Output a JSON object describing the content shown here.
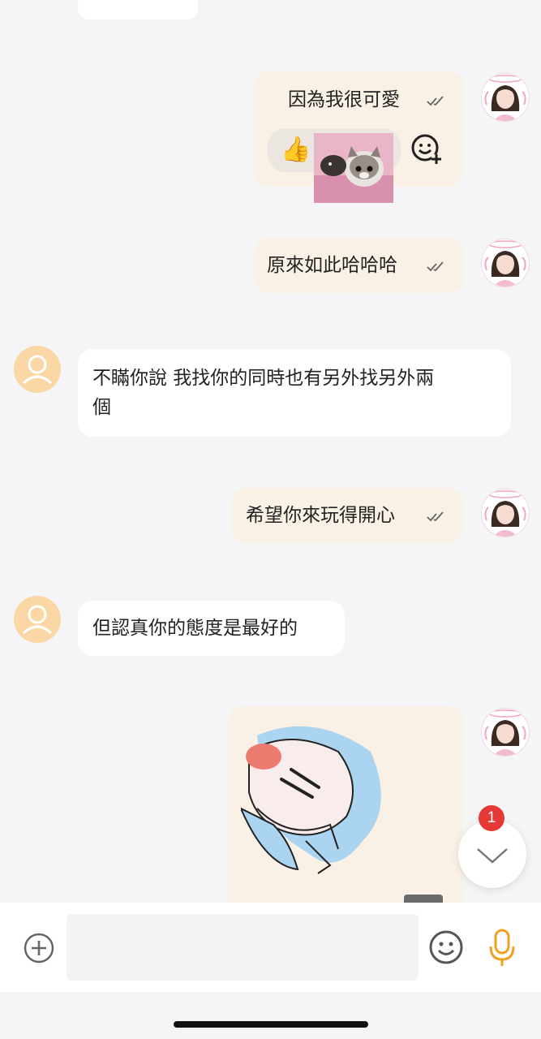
{
  "messages": [
    {
      "id": "m1",
      "direction": "outgoing",
      "text": "因為我很可愛",
      "status": "read",
      "reaction": {
        "emoji": "👍",
        "sticker": "kitten-sticker"
      }
    },
    {
      "id": "m2",
      "direction": "outgoing",
      "text": "原來如此哈哈哈",
      "status": "read"
    },
    {
      "id": "m3",
      "direction": "incoming",
      "lines": [
        "不瞞你說 我找你的同時也有另外找另外兩",
        "個"
      ]
    },
    {
      "id": "m4",
      "direction": "outgoing",
      "text": "希望你來玩得開心",
      "status": "read"
    },
    {
      "id": "m5",
      "direction": "incoming",
      "text": "但認真你的態度是最好的"
    },
    {
      "id": "m6",
      "direction": "outgoing",
      "type": "sticker",
      "sticker": "anime-sleeping-sticker"
    }
  ],
  "reaction_emoji": "👍",
  "scroll_down": {
    "unread_count": "1"
  },
  "composer": {
    "placeholder": ""
  },
  "icons": {
    "read_status": "double-check-icon",
    "add_reaction": "emoji-add-icon",
    "attach": "plus-circle-icon",
    "emoji": "smiley-icon",
    "voice": "microphone-icon"
  },
  "colors": {
    "background": "#f5f5f7",
    "outgoing_bubble": "#faf1e6",
    "incoming_bubble": "#ffffff",
    "badge": "#e53935",
    "mic": "#f0a020"
  }
}
